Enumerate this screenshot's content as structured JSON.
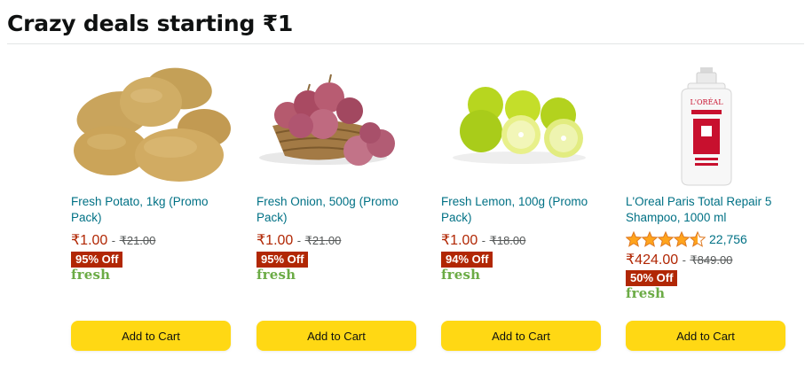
{
  "section": {
    "title": "Crazy deals starting ₹1"
  },
  "products": [
    {
      "title": "Fresh Potato, 1kg (Promo Pack)",
      "price": "₹1.00",
      "mrp": "₹21.00",
      "discount": "95% Off",
      "fresh_label": "fresh",
      "button": "Add to Cart",
      "image": "potatoes-image"
    },
    {
      "title": "Fresh Onion, 500g (Promo Pack)",
      "price": "₹1.00",
      "mrp": "₹21.00",
      "discount": "95% Off",
      "fresh_label": "fresh",
      "button": "Add to Cart",
      "image": "onion-basket-image"
    },
    {
      "title": "Fresh Lemon, 100g (Promo Pack)",
      "price": "₹1.00",
      "mrp": "₹18.00",
      "discount": "94% Off",
      "fresh_label": "fresh",
      "button": "Add to Cart",
      "image": "lemons-image"
    },
    {
      "title": "L'Oreal Paris Total Repair 5 Shampoo, 1000 ml",
      "rating": 4.5,
      "rating_count": "22,756",
      "price": "₹424.00",
      "mrp": "₹849.00",
      "discount": "50% Off",
      "fresh_label": "fresh",
      "button": "Add to Cart",
      "image": "shampoo-bottle-image"
    }
  ],
  "price_separator": "-",
  "colors": {
    "link": "#007185",
    "price": "#B12704",
    "badge": "#B12704",
    "fresh": "#6bab45",
    "button": "#FFD814",
    "star": "#FFA41C"
  }
}
